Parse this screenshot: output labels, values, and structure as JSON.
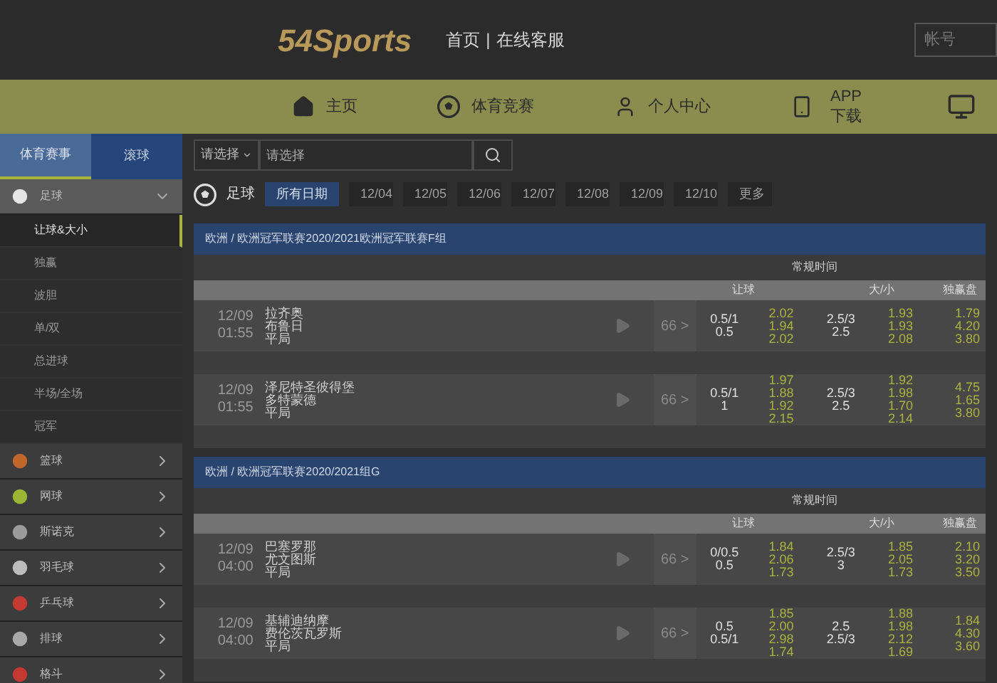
{
  "header": {
    "logo": "54Sports",
    "links": [
      "首页",
      "在线客服"
    ],
    "separator": "|",
    "account": {
      "placeholder": "帐号"
    }
  },
  "nav": [
    {
      "kind": "home",
      "label": "主页"
    },
    {
      "kind": "ball",
      "label": "体育竞赛"
    },
    {
      "kind": "user",
      "label": "个人中心"
    },
    {
      "kind": "phone",
      "label": "APP下载"
    },
    {
      "kind": "tv"
    }
  ],
  "sidebar": {
    "tabs": [
      {
        "label": "体育赛事",
        "selected": true
      },
      {
        "label": "滚球",
        "selected": false
      }
    ],
    "sports": [
      {
        "kind": "football",
        "label": "足球",
        "expanded": true,
        "children": [
          {
            "label": "让球&大小",
            "selected": true
          },
          {
            "label": "独赢",
            "selected": false
          },
          {
            "label": "波胆",
            "selected": false
          },
          {
            "label": "单/双",
            "selected": false
          },
          {
            "label": "总进球",
            "selected": false
          },
          {
            "label": "半场/全场",
            "selected": false
          },
          {
            "label": "冠军",
            "selected": false
          }
        ]
      },
      {
        "kind": "basketball",
        "label": "篮球",
        "expanded": false
      },
      {
        "kind": "tennis",
        "label": "网球",
        "expanded": false
      },
      {
        "kind": "snooker",
        "label": "斯诺克",
        "expanded": false
      },
      {
        "kind": "badminton",
        "label": "羽毛球",
        "expanded": false
      },
      {
        "kind": "table-tennis",
        "label": "乒乓球",
        "expanded": false
      },
      {
        "kind": "volleyball",
        "label": "排球",
        "expanded": false
      },
      {
        "kind": "boxing",
        "label": "格斗",
        "expanded": false
      }
    ]
  },
  "filter": {
    "select": "请选择",
    "search": {
      "placeholder": "请选择"
    }
  },
  "dates": {
    "sport": "足球",
    "items": [
      {
        "label": "所有日期",
        "selected": true
      },
      {
        "label": "12/04",
        "selected": false
      },
      {
        "label": "12/05",
        "selected": false
      },
      {
        "label": "12/06",
        "selected": false
      },
      {
        "label": "12/07",
        "selected": false
      },
      {
        "label": "12/08",
        "selected": false
      },
      {
        "label": "12/09",
        "selected": false
      },
      {
        "label": "12/10",
        "selected": false
      },
      {
        "label": "更多",
        "selected": false
      }
    ]
  },
  "leagues": [
    {
      "title": "欧洲 / 欧洲冠军联赛2020/2021欧洲冠军联赛F组",
      "period": "常规时间",
      "columns": [
        "让球",
        "大/小",
        "独赢盘"
      ],
      "matches": [
        {
          "date": "12/09",
          "time": "01:55",
          "teams": [
            "拉齐奥",
            "布鲁日",
            "平局"
          ],
          "markets": "66 >",
          "hdp": [
            "0.5/1",
            "0.5"
          ],
          "hdp_odds": [
            "2.02",
            "1.94",
            "2.02"
          ],
          "ou": [
            "2.5/3",
            "2.5"
          ],
          "ou_odds": [
            "1.93",
            "1.93",
            "2.08"
          ],
          "win": [
            "1.79",
            "4.20",
            "3.80"
          ]
        },
        {
          "date": "12/09",
          "time": "01:55",
          "teams": [
            "泽尼特圣彼得堡",
            "多特蒙德",
            "平局"
          ],
          "markets": "66 >",
          "hdp": [
            "0.5/1",
            "1"
          ],
          "hdp_odds": [
            "1.97",
            "1.88",
            "1.92",
            "2.15"
          ],
          "ou": [
            "2.5/3",
            "2.5"
          ],
          "ou_odds": [
            "1.92",
            "1.98",
            "1.70",
            "2.14"
          ],
          "win": [
            "4.75",
            "1.65",
            "3.80"
          ]
        }
      ]
    },
    {
      "title": "欧洲 / 欧洲冠军联赛2020/2021组G",
      "period": "常规时间",
      "columns": [
        "让球",
        "大/小",
        "独赢盘"
      ],
      "matches": [
        {
          "date": "12/09",
          "time": "04:00",
          "teams": [
            "巴塞罗那",
            "尤文图斯",
            "平局"
          ],
          "markets": "66 >",
          "hdp": [
            "0/0.5",
            "0.5"
          ],
          "hdp_odds": [
            "1.84",
            "2.06",
            "1.73"
          ],
          "ou": [
            "2.5/3",
            "3"
          ],
          "ou_odds": [
            "1.85",
            "2.05",
            "1.73"
          ],
          "win": [
            "2.10",
            "3.20",
            "3.50"
          ]
        },
        {
          "date": "12/09",
          "time": "04:00",
          "teams": [
            "基辅迪纳摩",
            "费伦茨瓦罗斯",
            "平局"
          ],
          "markets": "66 >",
          "hdp": [
            "0.5",
            "0.5/1"
          ],
          "hdp_odds": [
            "1.85",
            "2.00",
            "2.98",
            "1.74"
          ],
          "ou": [
            "2.5",
            "2.5/3"
          ],
          "ou_odds": [
            "1.88",
            "1.98",
            "2.12",
            "1.69"
          ],
          "win": [
            "1.84",
            "4.30",
            "3.60"
          ]
        }
      ]
    }
  ]
}
